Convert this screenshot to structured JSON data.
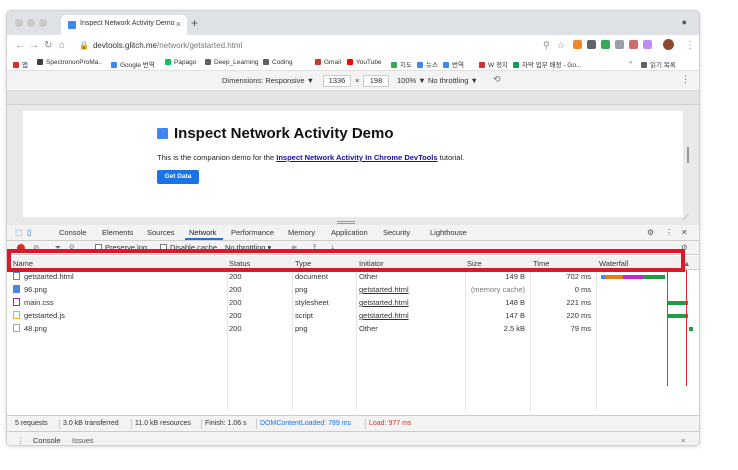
{
  "browser": {
    "tab": {
      "title": "Inspect Network Activity Demo",
      "close": "×"
    },
    "new_tab": "+",
    "url_host": "devtools.glitch.me",
    "url_path": "/network/getstarted.html",
    "bookmarks": [
      {
        "label": "SpectrononProMa..",
        "color": "#3c4043"
      },
      {
        "label": "Google 번역",
        "color": "#4285f4"
      },
      {
        "label": "Papago",
        "color": "#03c75a"
      },
      {
        "label": "Deep_Learning",
        "color": "#5f6368"
      },
      {
        "label": "Coding",
        "color": "#5f6368"
      },
      {
        "label": "Gmail",
        "color": "#d93025"
      },
      {
        "label": "YouTube",
        "color": "#ff0000"
      },
      {
        "label": "지도",
        "color": "#34a853"
      },
      {
        "label": "뉴스",
        "color": "#4285f4"
      },
      {
        "label": "번역",
        "color": "#4285f4"
      },
      {
        "label": "W 정지",
        "color": "#cc3333"
      },
      {
        "label": "자막 업무 배정 - Go...",
        "color": "#0f9d58"
      },
      {
        "label": "읽기 목록",
        "color": "#5f6368"
      }
    ],
    "apps_label": "앱"
  },
  "device_toolbar": {
    "dimensions": "Dimensions: Responsive ▼",
    "width": "1336",
    "times": "×",
    "height": "198",
    "zoom": "100% ▼",
    "throttle": "No throttling ▼"
  },
  "page": {
    "heading": "Inspect Network Activity Demo",
    "para_before": "This is the companion demo for the ",
    "para_link": "Inspect Network Activity In Chrome DevTools",
    "para_after": " tutorial.",
    "button": "Get Data"
  },
  "devtools": {
    "tabs": [
      "Console",
      "Elements",
      "Sources",
      "Network",
      "Performance",
      "Memory",
      "Application",
      "Security",
      "Lighthouse"
    ],
    "selected_tab": "Network",
    "toolbar": {
      "preserve_log": "Preserve log",
      "disable_cache": "Disable cache",
      "throttling": "No throttling"
    },
    "columns": [
      "Name",
      "Status",
      "Type",
      "Initiator",
      "Size",
      "Time",
      "Waterfall"
    ],
    "rows": [
      {
        "name": "getstarted.html",
        "status": "200",
        "type": "document",
        "initiator": "Other",
        "size": "149 B",
        "time": "702 ms",
        "icon_color": "#4a86e8",
        "initiator_link": false
      },
      {
        "name": "96.png",
        "status": "200",
        "type": "png",
        "initiator": "getstarted.html",
        "size": "(memory cache)",
        "time": "0 ms",
        "icon_color": "#4a86e8",
        "initiator_link": true
      },
      {
        "name": "main.css",
        "status": "200",
        "type": "stylesheet",
        "initiator": "getstarted.html",
        "size": "148 B",
        "time": "221 ms",
        "icon_color": "#9c27b0",
        "initiator_link": true
      },
      {
        "name": "getstarted.js",
        "status": "200",
        "type": "script",
        "initiator": "getstarted.html",
        "size": "147 B",
        "time": "220 ms",
        "icon_color": "#f4b400",
        "initiator_link": true
      },
      {
        "name": "48.png",
        "status": "200",
        "type": "png",
        "initiator": "Other",
        "size": "2.5 kB",
        "time": "79 ms",
        "icon_color": "#aaaaaa",
        "initiator_link": false
      }
    ],
    "status_bar": {
      "requests": "5 requests",
      "transferred": "3.0 kB transferred",
      "resources": "11.0 kB resources",
      "finish": "Finish: 1.06 s",
      "dcl": "DOMContentLoaded: 789 ms",
      "load": "Load: 977 ms"
    },
    "drawer": {
      "console": "Console",
      "issues": "Issues",
      "close": "×"
    }
  }
}
